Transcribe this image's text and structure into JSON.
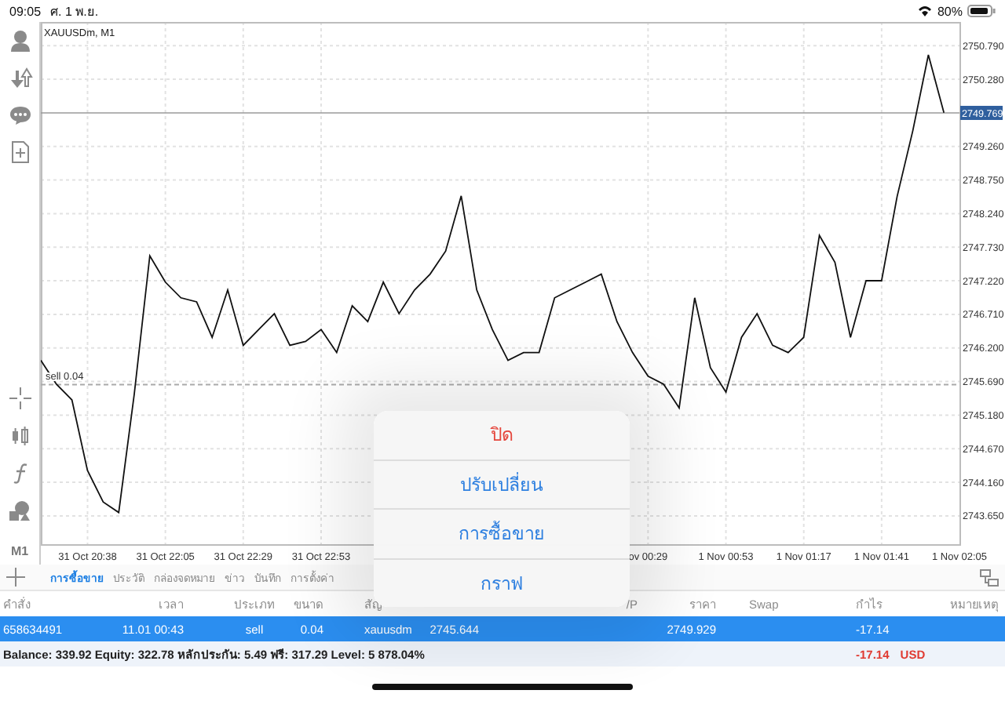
{
  "status_bar": {
    "time": "09:05",
    "date": "ศ. 1 พ.ย.",
    "battery": "80%"
  },
  "toolbar": {
    "timeframe": "M1"
  },
  "chart": {
    "title": "XAUUSDm, M1",
    "chart_data": {
      "type": "line",
      "categories": [
        null,
        null,
        null,
        "31 Oct 20:38",
        null,
        null,
        null,
        null,
        "31 Oct 22:05",
        null,
        null,
        null,
        null,
        "31 Oct 22:29",
        null,
        null,
        null,
        null,
        "31 Oct 22:53",
        null,
        null,
        null,
        null,
        null,
        null,
        null,
        null,
        null,
        null,
        null,
        null,
        null,
        null,
        null,
        null,
        null,
        null,
        null,
        null,
        "ov 00:29",
        null,
        null,
        null,
        null,
        "1 Nov 00:53",
        null,
        null,
        null,
        null,
        "1 Nov 01:17",
        null,
        null,
        null,
        null,
        "1 Nov 01:41",
        null,
        null,
        null,
        null,
        "1 Nov 02:05"
      ],
      "grid": true,
      "series": [
        {
          "color": "#111111",
          "values": [
            2746.01,
            2745.65,
            2745.41,
            2744.34,
            2743.86,
            2743.7,
            2745.5,
            2747.6,
            2747.2,
            2746.96,
            2746.9,
            2746.36,
            2747.08,
            2746.24,
            2746.48,
            2746.72,
            2746.24,
            2746.3,
            2746.48,
            2746.13,
            2746.84,
            2746.6,
            2747.2,
            2746.72,
            2747.08,
            2747.32,
            2747.67,
            2748.51,
            2747.08,
            2746.48,
            2746.01,
            2746.13,
            2746.13,
            2746.96,
            2747.08,
            2747.2,
            2747.32,
            2746.6,
            2746.13,
            2745.77,
            2745.65,
            2745.29,
            2746.96,
            2745.9,
            2745.53,
            2746.36,
            2746.72,
            2746.24,
            2746.13,
            2746.36,
            2747.91,
            2747.5,
            2746.36,
            2747.22,
            2747.22,
            2748.5,
            2749.5,
            2750.65,
            2749.77,
            null
          ]
        }
      ],
      "ylim": [
        2743.22,
        2751.15
      ],
      "yticks": [
        {
          "value": 2750.79,
          "label": "2750.790"
        },
        {
          "value": 2750.28,
          "label": "2750.280"
        },
        {
          "value": 2749.26,
          "label": "2749.260"
        },
        {
          "value": 2748.75,
          "label": "2748.750"
        },
        {
          "value": 2748.24,
          "label": "2748.240"
        },
        {
          "value": 2747.73,
          "label": "2747.730"
        },
        {
          "value": 2747.22,
          "label": "2747.220"
        },
        {
          "value": 2746.71,
          "label": "2746.710"
        },
        {
          "value": 2746.2,
          "label": "2746.200"
        },
        {
          "value": 2745.69,
          "label": "2745.690"
        },
        {
          "value": 2745.18,
          "label": "2745.180"
        },
        {
          "value": 2744.67,
          "label": "2744.670"
        },
        {
          "value": 2744.16,
          "label": "2744.160"
        },
        {
          "value": 2743.65,
          "label": "2743.650"
        }
      ],
      "ref_lines": [
        {
          "axis": "y",
          "value": 2749.769,
          "label": "2749.769"
        },
        {
          "axis": "y",
          "value": 2745.644,
          "label": "sell 0.04"
        }
      ]
    }
  },
  "tabs": [
    {
      "label": "การซื้อขาย",
      "selected": true
    },
    {
      "label": "ประวัติ",
      "selected": false
    },
    {
      "label": "กล่องจดหมาย",
      "selected": false
    },
    {
      "label": "ข่าว",
      "selected": false
    },
    {
      "label": "บันทึก",
      "selected": false
    },
    {
      "label": "การตั้งค่า",
      "selected": false
    }
  ],
  "positions": {
    "columns": [
      "คำสั่ง",
      "เวลา",
      "ประเภท",
      "ขนาด",
      "สัญ",
      null,
      null,
      "/P",
      "ราคา",
      "Swap",
      "กำไร",
      "หมายเหตุ"
    ],
    "rows": [
      {
        "selected": true,
        "cells": [
          "658634491",
          "11.01 00:43",
          "sell",
          "0.04",
          "xauusdm",
          "2745.644",
          null,
          null,
          "2749.929",
          null,
          "-17.14",
          null
        ]
      }
    ]
  },
  "summary": {
    "text": "Balance: 339.92 Equity: 322.78 หลักประกัน: 5.49 ฟรี: 317.29 Level: 5 878.04%",
    "profit": "-17.14",
    "currency": "USD"
  },
  "menu": [
    {
      "label": "ปิด",
      "kind": "destructive"
    },
    {
      "label": "ปรับเปลี่ยน",
      "kind": "action"
    },
    {
      "label": "การซื้อขาย",
      "kind": "action"
    },
    {
      "label": "กราฟ",
      "kind": "action"
    }
  ]
}
